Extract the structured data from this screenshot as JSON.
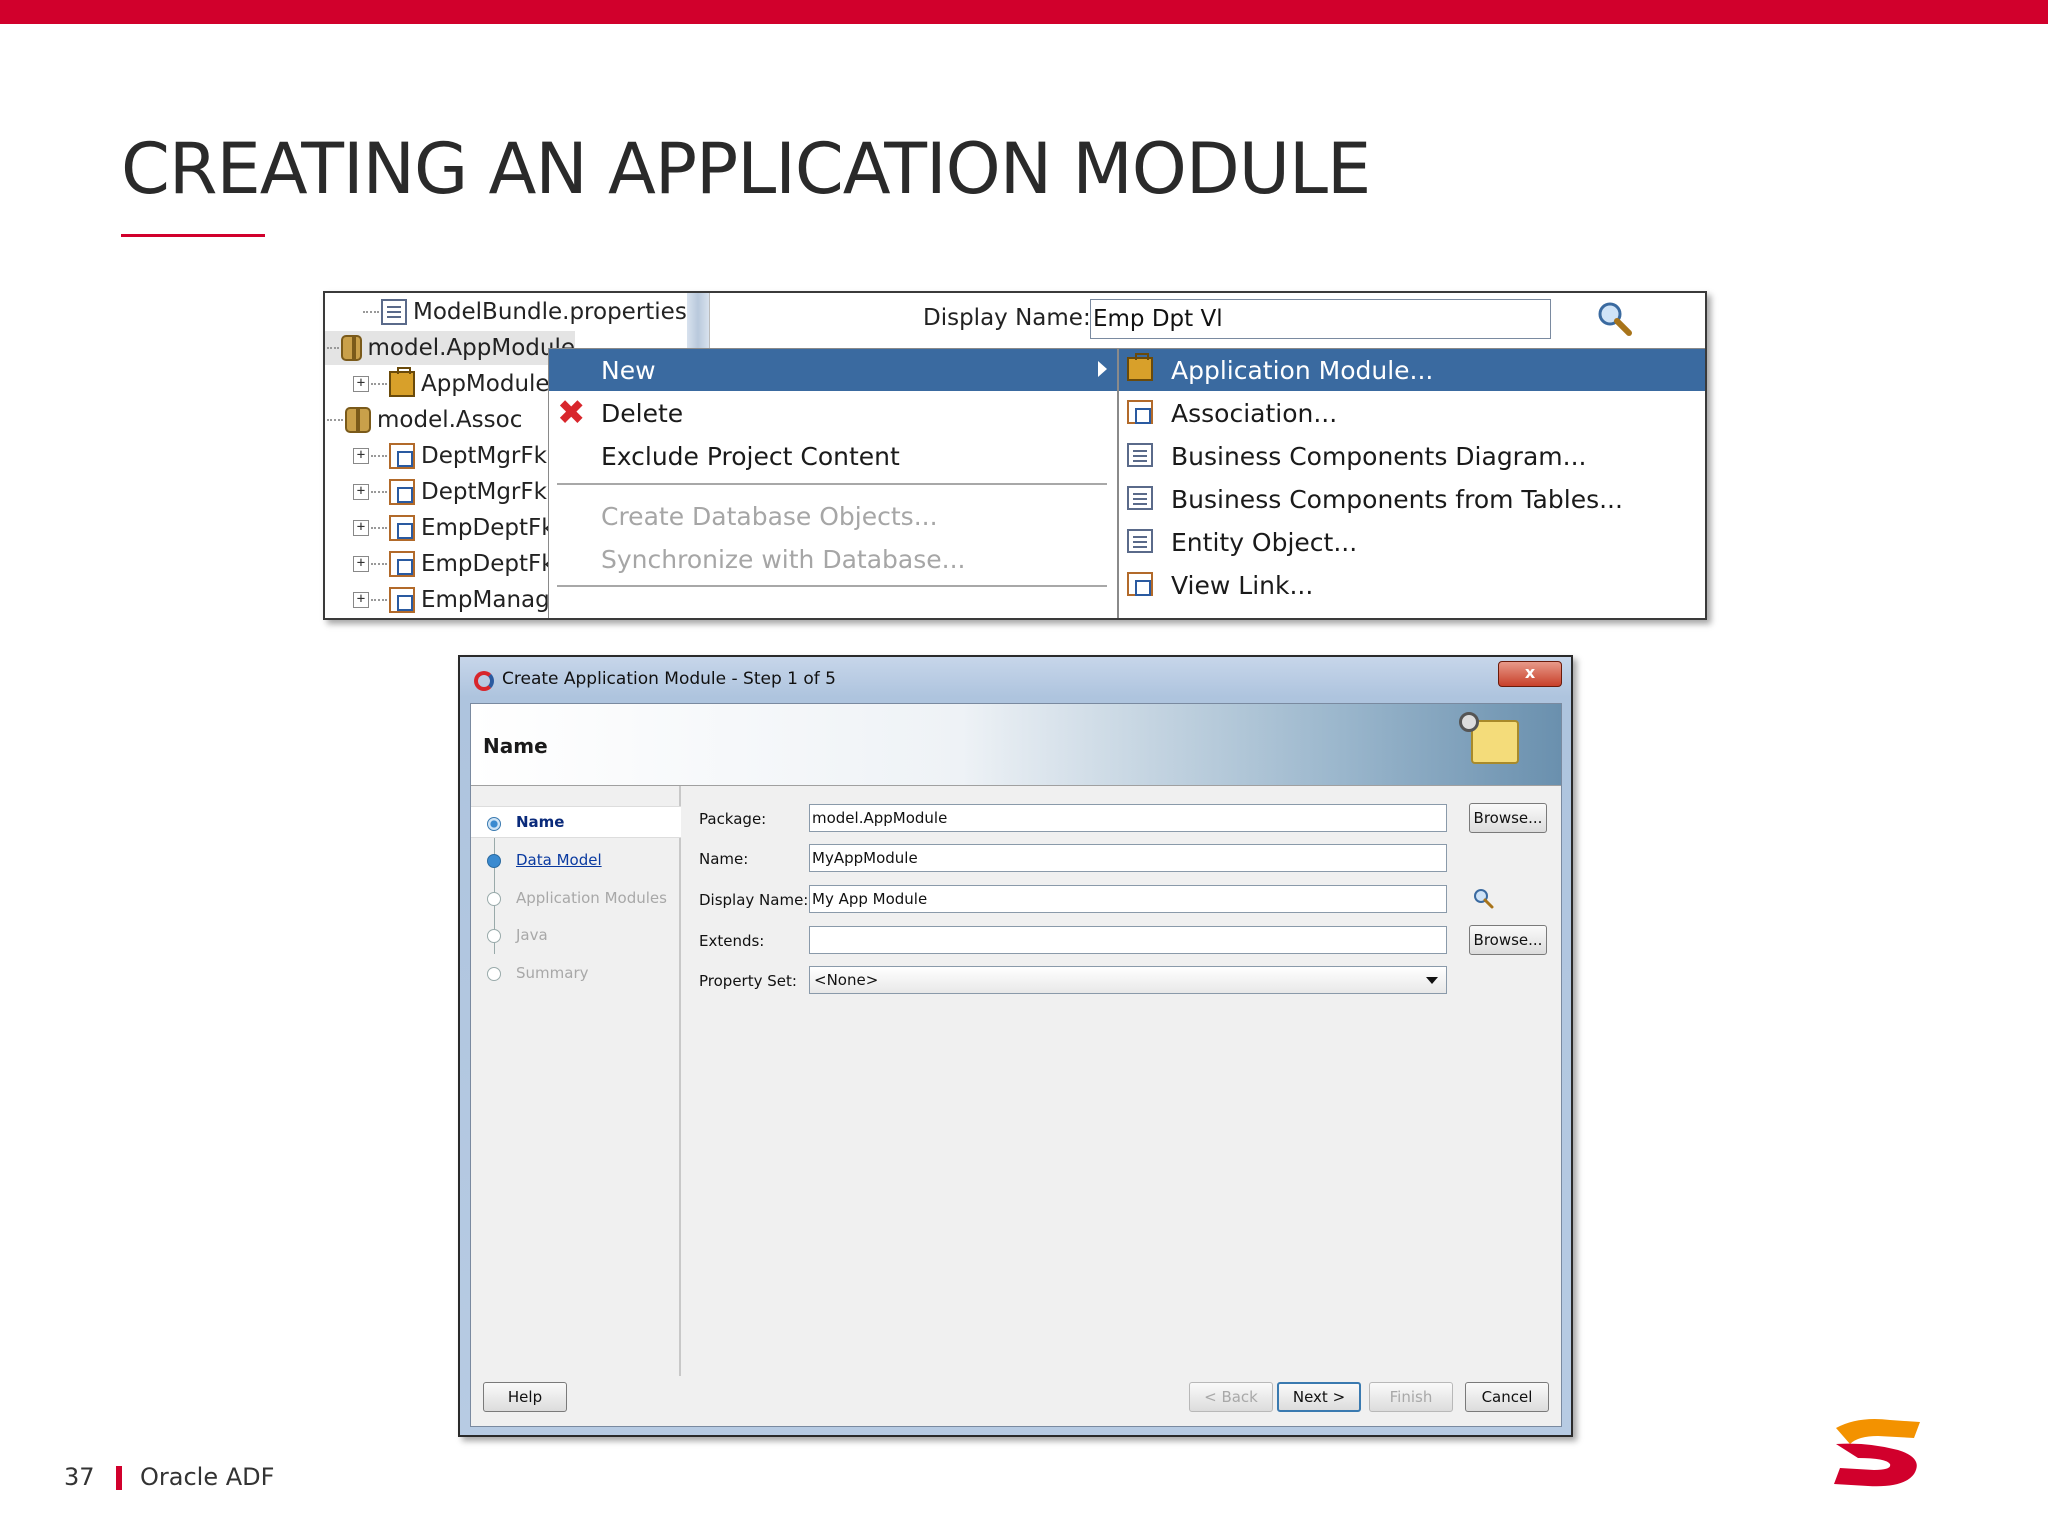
{
  "slide": {
    "title": "CREATING AN APPLICATION MODULE",
    "page_number": "37",
    "footer_text": "Oracle ADF",
    "accent_color": "#d1002c"
  },
  "top_screenshot": {
    "tree": {
      "items": [
        {
          "label": "ModelBundle.properties",
          "icon": "properties-file-icon"
        },
        {
          "label": "model.AppModule",
          "icon": "package-icon"
        },
        {
          "label": "AppModule",
          "icon": "application-module-icon"
        },
        {
          "label": "model.Assoc",
          "icon": "package-icon"
        },
        {
          "label": "DeptMgrFk",
          "icon": "view-object-icon"
        },
        {
          "label": "DeptMgrFk",
          "icon": "view-object-icon"
        },
        {
          "label": "EmpDeptFk",
          "icon": "view-object-icon"
        },
        {
          "label": "EmpDeptFk",
          "icon": "view-object-icon"
        },
        {
          "label": "EmpManag",
          "icon": "view-object-icon"
        }
      ]
    },
    "display_name": {
      "label": "Display Name:",
      "value": "Emp Dpt Vl"
    },
    "context_menu": {
      "items": [
        {
          "label": "New",
          "state": "highlighted",
          "has_submenu": true
        },
        {
          "label": "Delete",
          "state": "enabled",
          "icon": "delete-x-icon"
        },
        {
          "label": "Exclude Project Content",
          "state": "enabled"
        },
        {
          "label": "Create Database Objects...",
          "state": "disabled"
        },
        {
          "label": "Synchronize with Database...",
          "state": "disabled"
        }
      ]
    },
    "submenu": {
      "items": [
        {
          "label": "Application Module...",
          "state": "highlighted",
          "icon": "application-module-icon"
        },
        {
          "label": "Association...",
          "state": "enabled",
          "icon": "association-icon"
        },
        {
          "label": "Business Components Diagram...",
          "state": "enabled",
          "icon": "diagram-icon"
        },
        {
          "label": "Business Components from Tables...",
          "state": "enabled",
          "icon": "tables-icon"
        },
        {
          "label": "Entity Object...",
          "state": "enabled",
          "icon": "entity-object-icon"
        },
        {
          "label": "View Link...",
          "state": "enabled",
          "icon": "view-link-icon"
        }
      ]
    }
  },
  "dialog": {
    "title": "Create Application Module - Step 1 of 5",
    "close_label": "x",
    "header_title": "Name",
    "steps": [
      {
        "label": "Name",
        "state": "current"
      },
      {
        "label": "Data Model",
        "state": "link"
      },
      {
        "label": "Application Modules",
        "state": "disabled"
      },
      {
        "label": "Java",
        "state": "disabled"
      },
      {
        "label": "Summary",
        "state": "disabled"
      }
    ],
    "form": {
      "package_label": "Package:",
      "package_value": "model.AppModule",
      "name_label": "Name:",
      "name_value": "MyAppModule",
      "display_name_label": "Display Name:",
      "display_name_value": "My App Module",
      "extends_label": "Extends:",
      "extends_value": "",
      "property_set_label": "Property Set:",
      "property_set_value": "<None>",
      "browse_label": "Browse..."
    },
    "buttons": {
      "help": "Help",
      "back": "< Back",
      "next": "Next >",
      "finish": "Finish",
      "cancel": "Cancel"
    }
  }
}
